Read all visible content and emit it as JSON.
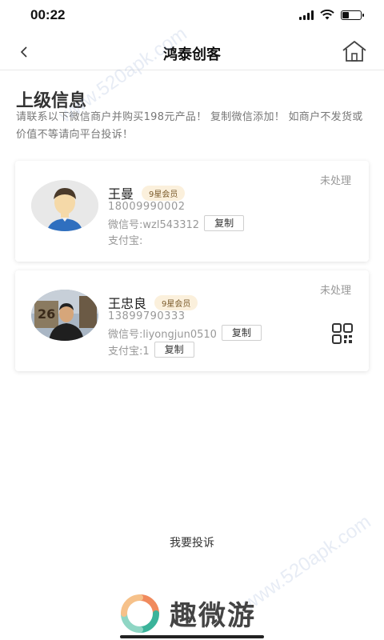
{
  "status_bar": {
    "time": "00:22"
  },
  "nav": {
    "title": "鸿泰创客"
  },
  "section": {
    "title": "上级信息",
    "notice": "请联系以下微信商户并购买198元产品！ 复制微信添加！ 如商户不发货或价值不等请向平台投诉！"
  },
  "members": [
    {
      "name": "王曼",
      "badge": "9星会员",
      "status": "未处理",
      "phone": "18009990002",
      "wechat": "微信号:wzl543312",
      "alipay": "支付宝:",
      "copy_label": "复制"
    },
    {
      "name": "王忠良",
      "badge": "9星会员",
      "status": "未处理",
      "phone": "13899790333",
      "wechat": "微信号:liyongjun0510",
      "alipay": "支付宝:1",
      "copy_label": "复制"
    }
  ],
  "complain_label": "我要投诉",
  "brand": {
    "name": "趣微游"
  },
  "watermark": "www.520apk.com"
}
